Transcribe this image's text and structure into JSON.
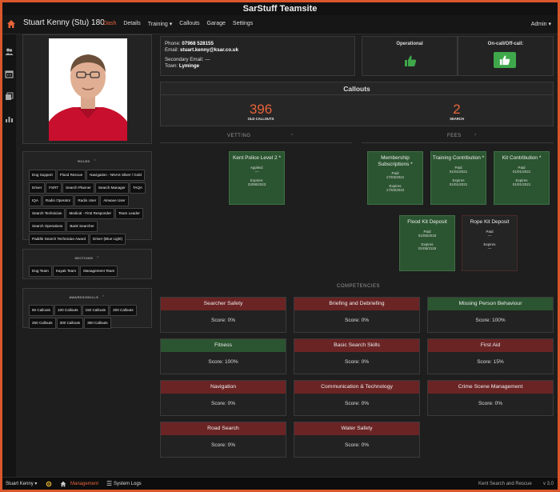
{
  "app_title": "SarStuff Teamsite",
  "member": {
    "name": "Stuart Kenny (Stu) 180"
  },
  "nav": [
    {
      "label": "Dash",
      "active": true
    },
    {
      "label": "Details",
      "active": false
    },
    {
      "label": "Training ▾",
      "active": false
    },
    {
      "label": "Callouts",
      "active": false
    },
    {
      "label": "Garage",
      "active": false
    },
    {
      "label": "Settings",
      "active": false
    }
  ],
  "admin_label": "Admin ▾",
  "contact": {
    "phone_label": "Phone:",
    "phone": "07968 528155",
    "email_label": "Email:",
    "email": "stuart.kenny@ksar.co.uk",
    "secondary_label": "Secondary Email:",
    "secondary": "—",
    "town_label": "Town:",
    "town": "Lyminge"
  },
  "status": {
    "operational_label": "Operational",
    "oncall_label": "On-call/Off-call:"
  },
  "roles": {
    "title": "ROLES",
    "items": [
      "Dog Support",
      "Flood Rescue",
      "Navigation - NNAS Silver / Gold",
      "Driver",
      "FSRT",
      "Search Planner",
      "Search Manager",
      "TAQA",
      "IQA",
      "Radio Operator",
      "Radio User",
      "Airwave User",
      "Search Technician",
      "Medical - First Responder",
      "Team Leader",
      "Search Operations",
      "Bank Searcher",
      "Paddle Search Technician Award",
      "Driver (Blue Light)"
    ]
  },
  "sections": {
    "title": "SECTIONS",
    "items": [
      "Dog Team",
      "Kayak Team",
      "Management Team"
    ]
  },
  "awards": {
    "title": "AWARDS/SKILLS",
    "items": [
      "50 Callouts",
      "100 Callouts",
      "150 Callouts",
      "200 Callouts",
      "250 Callouts",
      "300 Callouts",
      "350 Callouts"
    ]
  },
  "callouts": {
    "title": "Callouts",
    "old_count": "396",
    "old_label": "OLD CALLOUTS",
    "search_count": "2",
    "search_label": "SEARCH"
  },
  "vetting": {
    "title": "VETTING",
    "cards": [
      {
        "title": "Kent Police Level 2 *",
        "l1": "Applied:",
        "v1": "—",
        "l2": "Expires:",
        "v2": "23/08/2023"
      }
    ]
  },
  "fees": {
    "title": "FEES",
    "cards": [
      {
        "title": "Membership Subscriptions *",
        "l1": "Paid",
        "v1": "17/03/2021",
        "l2": "Expires",
        "v2": "17/03/2022",
        "status": "green"
      },
      {
        "title": "Training Contribution *",
        "l1": "Paid",
        "v1": "01/01/2021",
        "l2": "Expires",
        "v2": "01/01/2021",
        "status": "green"
      },
      {
        "title": "Kit Contribution *",
        "l1": "Paid",
        "v1": "01/01/2021",
        "l2": "Expires",
        "v2": "01/01/2021",
        "status": "green"
      },
      {
        "title": "Flood Kit Deposit",
        "l1": "Paid",
        "v1": "01/06/2019",
        "l2": "Expires",
        "v2": "01/06/2119",
        "status": "green"
      },
      {
        "title": "Rope Kit Deposit",
        "l1": "Paid",
        "v1": "—",
        "l2": "Expires",
        "v2": "—",
        "status": "none"
      }
    ]
  },
  "competencies": {
    "title": "COMPETENCIES",
    "items": [
      {
        "name": "Searcher Safety",
        "score": "Score: 0%",
        "status": "red"
      },
      {
        "name": "Briefing and Debriefing",
        "score": "Score: 0%",
        "status": "red"
      },
      {
        "name": "Missing Person Behaviour",
        "score": "Score: 100%",
        "status": "green"
      },
      {
        "name": "Fitness",
        "score": "Score: 100%",
        "status": "green"
      },
      {
        "name": "Basic Search Skills",
        "score": "Score: 0%",
        "status": "red"
      },
      {
        "name": "First Aid",
        "score": "Score: 15%",
        "status": "red"
      },
      {
        "name": "Navigation",
        "score": "Score: 0%",
        "status": "red"
      },
      {
        "name": "Communication & Technology",
        "score": "Score: 0%",
        "status": "red"
      },
      {
        "name": "Crime Scene Management",
        "score": "Score: 0%",
        "status": "red"
      },
      {
        "name": "Road Search",
        "score": "Score: 0%",
        "status": "red"
      },
      {
        "name": "Water Safety",
        "score": "Score: 0%",
        "status": "red"
      }
    ]
  },
  "footer": {
    "user": "Stuart Kenny ▾",
    "management": "Management",
    "system_logs": "System Logs",
    "org": "Kent Search and Rescue",
    "version": "v 3.0"
  },
  "colors": {
    "accent": "#e8643a",
    "green": "#2b5530",
    "red": "#6b2424",
    "background": "#1e1e1e"
  }
}
